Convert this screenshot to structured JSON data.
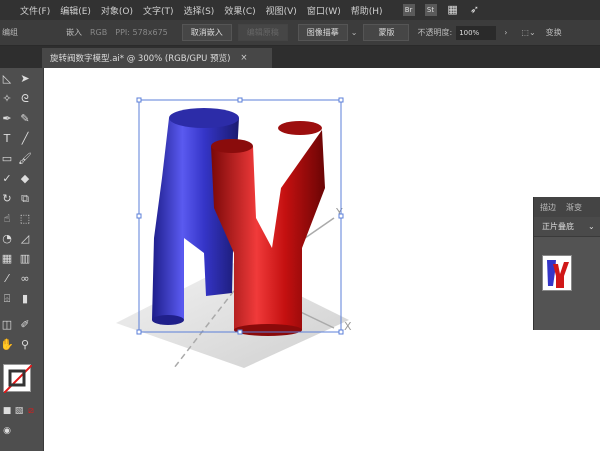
{
  "menu": [
    "文件(F)",
    "编辑(E)",
    "对象(O)",
    "文字(T)",
    "选择(S)",
    "效果(C)",
    "视图(V)",
    "窗口(W)",
    "帮助(H)"
  ],
  "menu_icons": [
    "Br",
    "St"
  ],
  "control": {
    "left_label": "编组",
    "embed": "嵌入",
    "color_mode": "RGB",
    "ppi": "PPI: 578x675",
    "unembed": "取消嵌入",
    "edit_original": "编辑原稿",
    "image_trace": "图像描摹",
    "mask": "蒙版",
    "opacity_label": "不透明度:",
    "opacity_value": "100%",
    "transform": "变换"
  },
  "tab": {
    "title": "旋转阀数字模型.ai* @ 300% (RGB/GPU 预览)",
    "close": "×"
  },
  "panel": {
    "tabs": [
      "描边",
      "渐变"
    ],
    "blend_mode": "正片叠底"
  },
  "colors": {
    "blue": "#3b3bd0",
    "red": "#cc1414",
    "selection": "#5b7fd8"
  }
}
